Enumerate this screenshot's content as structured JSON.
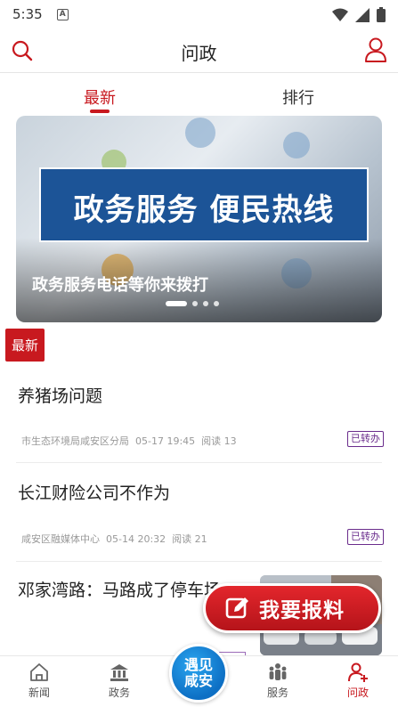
{
  "status_bar": {
    "time": "5:35",
    "notice_icon": "A"
  },
  "header": {
    "title": "问政"
  },
  "tabs": [
    {
      "label": "最新",
      "active": true
    },
    {
      "label": "排行",
      "active": false
    }
  ],
  "banner": {
    "headline": "政务服务  便民热线",
    "caption": "政务服务电话等你来拨打",
    "slide_count": 4,
    "active_slide": 1
  },
  "section_tag": "最新",
  "news": [
    {
      "title": "养猪场问题",
      "source": "市生态环境局咸安区分局",
      "date": "05-17 19:45",
      "reads": "阅读 13",
      "status": "已转办"
    },
    {
      "title": "长江财险公司不作为",
      "source": "咸安区融媒体中心",
      "date": "05-14 20:32",
      "reads": "阅读 21",
      "status": "已转办"
    },
    {
      "title": "邓家湾路：马路成了停车场",
      "source": "",
      "date": "",
      "reads": "",
      "status": ""
    }
  ],
  "report_button": {
    "label": "我要报料"
  },
  "bottom_nav": {
    "items": [
      {
        "label": "新闻",
        "icon": "home-icon",
        "active": false
      },
      {
        "label": "政务",
        "icon": "government-building-icon",
        "active": false
      },
      {
        "label": "服务",
        "icon": "people-icon",
        "active": false
      },
      {
        "label": "问政",
        "icon": "user-add-icon",
        "active": true
      }
    ],
    "center_logo": "遇见咸安"
  },
  "colors": {
    "accent": "#c8191f",
    "status_purple": "#6a2c8c",
    "banner_blue": "#1c5497"
  }
}
